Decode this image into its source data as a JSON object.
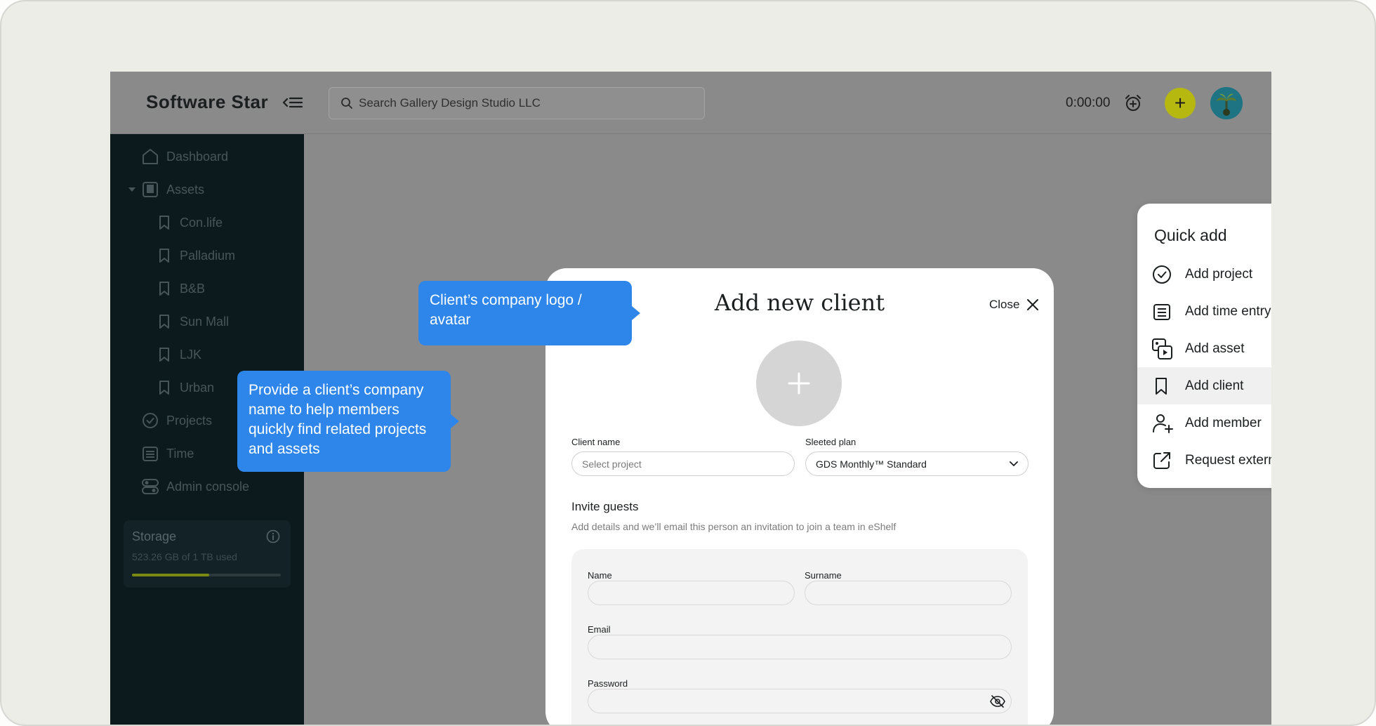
{
  "app": {
    "brand": "Software Star"
  },
  "header": {
    "search_placeholder": "Search Gallery Design Studio LLC",
    "timer": "0:00:00",
    "add_button": "+"
  },
  "sidebar": {
    "items": [
      {
        "label": "Dashboard",
        "icon": "home-icon"
      },
      {
        "label": "Assets",
        "icon": "assets-icon"
      },
      {
        "label": "Con.life",
        "icon": "bookmark-icon"
      },
      {
        "label": "Palladium",
        "icon": "bookmark-icon"
      },
      {
        "label": "B&B",
        "icon": "bookmark-icon"
      },
      {
        "label": "Sun Mall",
        "icon": "bookmark-icon"
      },
      {
        "label": "LJK",
        "icon": "bookmark-icon"
      },
      {
        "label": "Urban",
        "icon": "bookmark-icon"
      },
      {
        "label": "Projects",
        "icon": "check-circle-icon"
      },
      {
        "label": "Time",
        "icon": "calendar-icon"
      },
      {
        "label": "Admin console",
        "icon": "toggles-icon"
      }
    ],
    "storage": {
      "title": "Storage",
      "usage": "523.26 GB of 1 TB used",
      "fraction_used": 0.52
    }
  },
  "modal": {
    "title": "Add new client",
    "close_label": "Close",
    "client_name": {
      "label": "Client name",
      "placeholder": "Select project"
    },
    "plan": {
      "label": "Sleeted plan",
      "value": "GDS Monthly™ Standard"
    },
    "invite": {
      "title": "Invite guests",
      "subtitle": "Add details and we’ll email this person an invitation to join a team in eShelf",
      "name_label": "Name",
      "surname_label": "Surname",
      "email_label": "Email",
      "password_label": "Password"
    }
  },
  "tooltips": {
    "logo": "Client’s company logo / avatar",
    "name": "Provide a client’s company name to help members quickly find related projects and assets"
  },
  "quick_add": {
    "title": "Quick add",
    "items": [
      {
        "label": "Add project",
        "icon": "check-circle-icon"
      },
      {
        "label": "Add time entry",
        "icon": "calendar-icon"
      },
      {
        "label": "Add asset",
        "icon": "media-icon"
      },
      {
        "label": "Add client",
        "icon": "bookmark-icon"
      },
      {
        "label": "Add member",
        "icon": "add-user-icon"
      },
      {
        "label": "Request external assets",
        "icon": "external-link-icon"
      }
    ],
    "active_index": 3
  },
  "colors": {
    "accent": "#b6b80f",
    "tooltip": "#2f86ea",
    "sidebar": "#0c1a1d"
  }
}
